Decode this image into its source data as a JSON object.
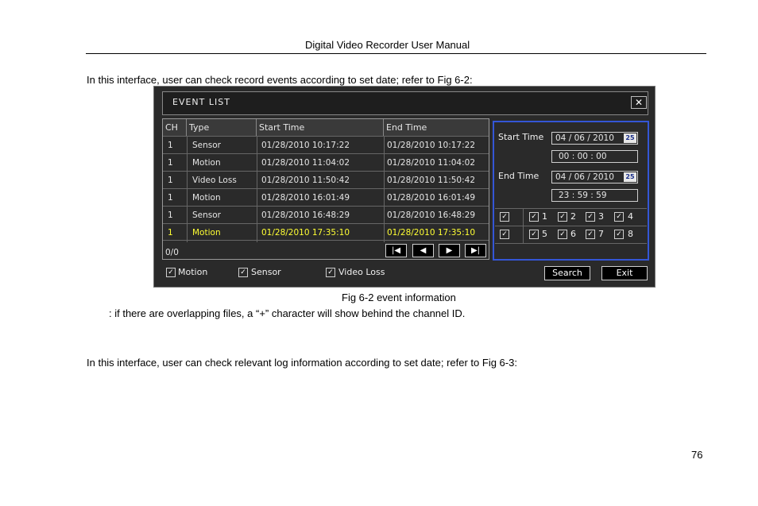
{
  "doc": {
    "header": "Digital Video Recorder User Manual",
    "intro": "In this interface, user can check record events according to set date; refer to Fig 6-2:",
    "caption": "Fig 6-2 event information",
    "note": ": if there are overlapping files, a “+” character will show behind the channel ID.",
    "log_intro": "In this interface, user can check relevant log information according to set date; refer to Fig 6-3:",
    "page_number": "76"
  },
  "dvr": {
    "title": "EVENT LIST",
    "close_icon": "close-icon",
    "columns": [
      "CH",
      "Type",
      "Start Time",
      "End Time"
    ],
    "rows": [
      {
        "ch": "1",
        "type": "Sensor",
        "start": "01/28/2010  10:17:22",
        "end": "01/28/2010  10:17:22"
      },
      {
        "ch": "1",
        "type": "Motion",
        "start": "01/28/2010  11:04:02",
        "end": "01/28/2010  11:04:02"
      },
      {
        "ch": "1",
        "type": "Video Loss",
        "start": "01/28/2010  11:50:42",
        "end": "01/28/2010  11:50:42"
      },
      {
        "ch": "1",
        "type": "Motion",
        "start": "01/28/2010  16:01:49",
        "end": "01/28/2010  16:01:49"
      },
      {
        "ch": "1",
        "type": "Sensor",
        "start": "01/28/2010  16:48:29",
        "end": "01/28/2010  16:48:29"
      },
      {
        "ch": "1",
        "type": "Motion",
        "start": "01/28/2010  17:35:10",
        "end": "01/28/2010  17:35:10"
      }
    ],
    "selected_row_color": "#ffff33",
    "counter": "0/0",
    "nav_icons": [
      "first-page-icon",
      "prev-page-icon",
      "next-page-icon",
      "last-page-icon"
    ],
    "filter": {
      "start_label": "Start Time",
      "start_date": "04 / 06 / 2010",
      "start_time": "00 : 00 : 00",
      "end_label": "End Time",
      "end_date": "04 / 06 / 2010",
      "end_time": "23 : 59 : 59",
      "calendar_text": "25",
      "channels_row1": [
        "1",
        "2",
        "3",
        "4"
      ],
      "channels_row2": [
        "5",
        "6",
        "7",
        "8"
      ],
      "accent": "#3456d6"
    },
    "event_types": [
      "Motion",
      "Sensor",
      "Video Loss"
    ],
    "search_label": "Search",
    "exit_label": "Exit"
  }
}
